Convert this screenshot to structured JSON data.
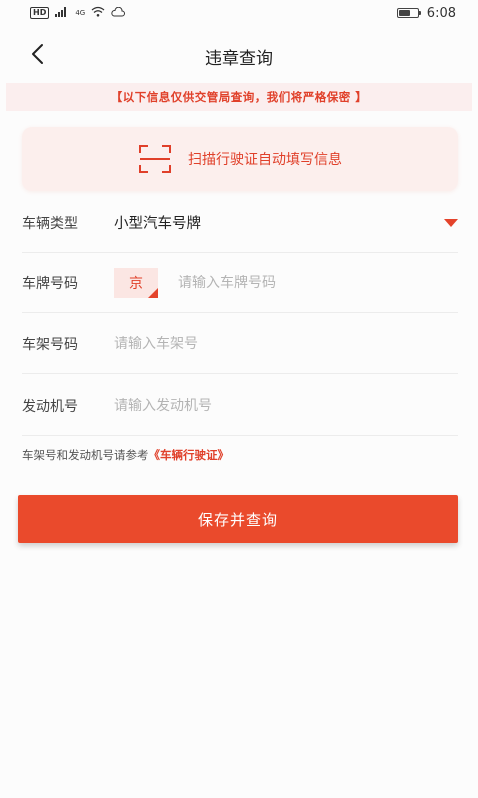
{
  "status_bar": {
    "hd": "HD",
    "network": "4G",
    "time": "6:08",
    "battery_level": 0.6
  },
  "header": {
    "title": "违章查询",
    "back_icon": "chevron-left-icon"
  },
  "notice": {
    "text": "【以下信息仅供交管局查询，我们将严格保密 】"
  },
  "scan": {
    "label": "扫描行驶证自动填写信息",
    "icon": "scan-frame-icon"
  },
  "form": {
    "vehicle_type": {
      "label": "车辆类型",
      "value": "小型汽车号牌"
    },
    "plate_number": {
      "label": "车牌号码",
      "prefix": "京",
      "placeholder": "请输入车牌号码"
    },
    "frame_number": {
      "label": "车架号码",
      "placeholder": "请输入车架号"
    },
    "engine_number": {
      "label": "发动机号",
      "placeholder": "请输入发动机号"
    }
  },
  "hint": {
    "text": "车架号和发动机号请参考",
    "link": "《车辆行驶证》"
  },
  "submit": {
    "label": "保存并查询"
  },
  "colors": {
    "accent": "#ea4a2c",
    "notice_bg": "#fbeeee",
    "card_bg": "#fcefed"
  }
}
